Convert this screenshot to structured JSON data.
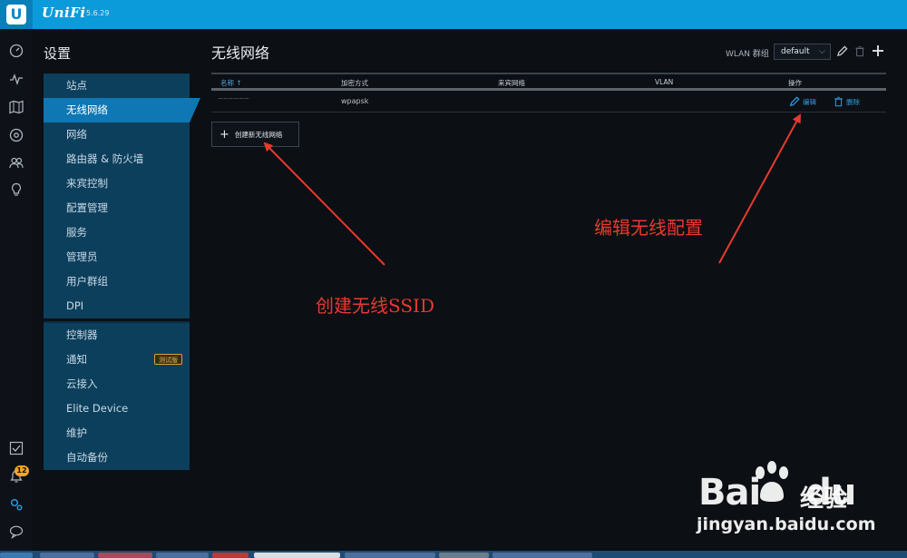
{
  "topbar": {
    "brand": "UniFi",
    "version": "5.6.29",
    "logo_letter": "U"
  },
  "rail": {
    "icons": [
      "dashboard-icon",
      "statistics-icon",
      "map-icon",
      "devices-icon",
      "clients-icon",
      "insights-icon",
      "tasks-icon",
      "alerts-icon",
      "settings-icon",
      "chat-icon"
    ],
    "alerts_count": "12"
  },
  "settings_nav": {
    "title": "设置",
    "group1": [
      {
        "label": "站点"
      },
      {
        "label": "无线网络",
        "active": true
      },
      {
        "label": "网络"
      },
      {
        "label": "路由器 & 防火墙"
      },
      {
        "label": "来宾控制"
      },
      {
        "label": "配置管理"
      },
      {
        "label": "服务"
      },
      {
        "label": "管理员"
      },
      {
        "label": "用户群组"
      },
      {
        "label": "DPI"
      }
    ],
    "group2": [
      {
        "label": "控制器"
      },
      {
        "label": "通知",
        "badge": "测试版"
      },
      {
        "label": "云接入"
      },
      {
        "label": "Elite Device"
      },
      {
        "label": "维护"
      },
      {
        "label": "自动备份"
      }
    ]
  },
  "main": {
    "title": "无线网络",
    "wlan_group_label": "WLAN 群组",
    "wlan_group_value": "default",
    "table": {
      "columns": [
        "名称 ↑",
        "加密方式",
        "来宾网络",
        "VLAN",
        "操作"
      ],
      "rows": [
        {
          "name": "~~~~~~",
          "security": "wpapsk",
          "guest": "",
          "vlan": "",
          "edit": "编辑",
          "delete": "删除"
        }
      ]
    },
    "create_button": "创建新无线网络"
  },
  "annotations": {
    "edit_note": "编辑无线配置",
    "create_note": "创建无线SSID",
    "color": "#e8392f"
  },
  "watermark": {
    "brand": "Bai",
    "brand2": "du",
    "product": "经验",
    "url": "jingyan.baidu.com"
  }
}
